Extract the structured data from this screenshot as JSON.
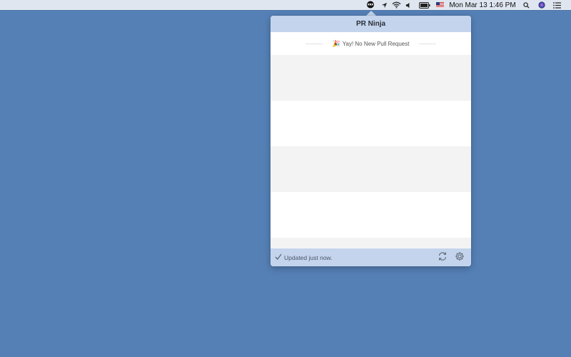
{
  "menubar": {
    "clock": "Mon Mar 13  1:46 PM",
    "icons": [
      "ninja-icon",
      "location-arrow-icon",
      "wifi-icon",
      "volume-icon",
      "battery-icon",
      "flag-us-icon",
      "spotlight-search-icon",
      "siri-icon",
      "notification-center-icon"
    ]
  },
  "popover": {
    "title": "PR Ninja",
    "empty_message": "Yay! No New Pull Request",
    "empty_emoji": "🎉",
    "status": "Updated just now.",
    "refresh_icon": "refresh-icon",
    "settings_icon": "gear-icon"
  },
  "colors": {
    "desktop": "#5580b6",
    "header": "#c3d4ec",
    "row_alt": "#f3f3f3"
  }
}
